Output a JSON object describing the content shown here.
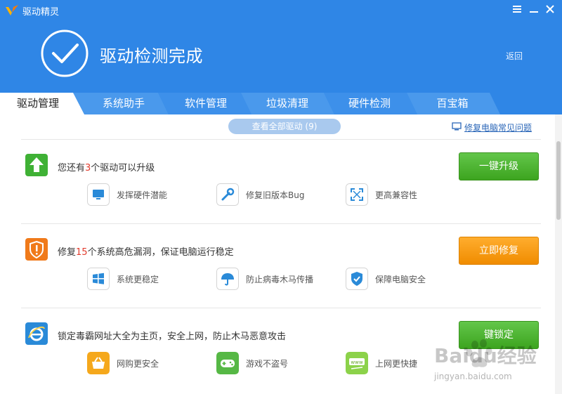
{
  "app": {
    "title": "驱动精灵",
    "headline": "驱动检测完成",
    "back": "返回"
  },
  "tabs": [
    "驱动管理",
    "系统助手",
    "软件管理",
    "垃圾清理",
    "硬件检测",
    "百宝箱"
  ],
  "toolbar": {
    "view_all": "查看全部驱动 (9)",
    "faq": "修复电脑常见问题"
  },
  "sections": [
    {
      "pre": "您还有",
      "num": "3",
      "post": "个驱动可以升级",
      "button": "一键升级",
      "features": [
        "发挥硬件潜能",
        "修复旧版本Bug",
        "更高兼容性"
      ]
    },
    {
      "pre": "修复",
      "num": "15",
      "post": "个系统高危漏洞，保证电脑运行稳定",
      "button": "立即修复",
      "features": [
        "系统更稳定",
        "防止病毒木马传播",
        "保障电脑安全"
      ]
    },
    {
      "text": "锁定毒霸网址大全为主页，安全上网，防止木马恶意攻击",
      "button": "键锁定",
      "features": [
        "网购更安全",
        "游戏不盗号",
        "上网更快捷"
      ]
    }
  ],
  "watermark": {
    "text": "Baidu经验",
    "sub": "jingyan.baidu.com"
  },
  "colors": {
    "header": "#2f86e6",
    "accent_green": "#3da41f",
    "accent_orange": "#f08c00",
    "highlight": "#e23b2d"
  }
}
